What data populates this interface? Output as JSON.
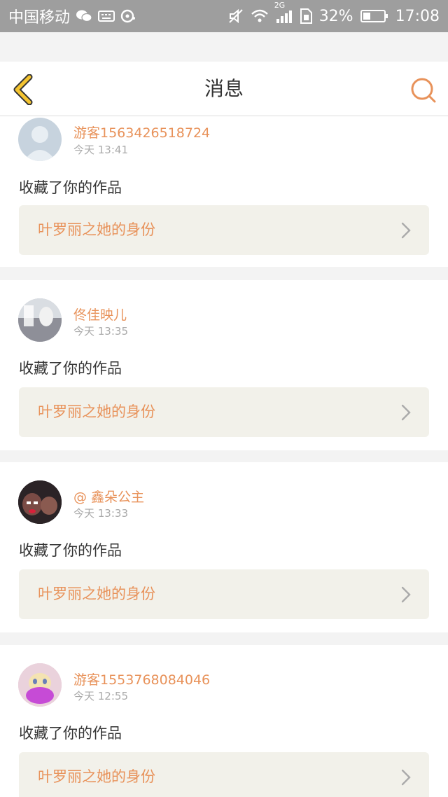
{
  "status_bar": {
    "carrier": "中国移动",
    "network": "2G",
    "battery": "32%",
    "time": "17:08"
  },
  "header": {
    "title": "消息",
    "back_icon": "chevron-left-icon",
    "search_icon": "search-icon"
  },
  "colors": {
    "accent": "#e8925a",
    "back_icon": "#f4c430",
    "card_bg": "#ffffff",
    "page_bg": "#f3f3f3",
    "work_bg": "#f2f1ea"
  },
  "messages": [
    {
      "user": "游客1563426518724",
      "time": "今天 13:41",
      "action": "收藏了你的作品",
      "work_title": "叶罗丽之她的身份"
    },
    {
      "user": "佟佳映儿",
      "time": "今天 13:35",
      "action": "收藏了你的作品",
      "work_title": "叶罗丽之她的身份"
    },
    {
      "user": "@ 鑫朵公主",
      "time": "今天 13:33",
      "action": "收藏了你的作品",
      "work_title": "叶罗丽之她的身份"
    },
    {
      "user": "游客1553768084046",
      "time": "今天 12:55",
      "action": "收藏了你的作品",
      "work_title": "叶罗丽之她的身份"
    }
  ]
}
